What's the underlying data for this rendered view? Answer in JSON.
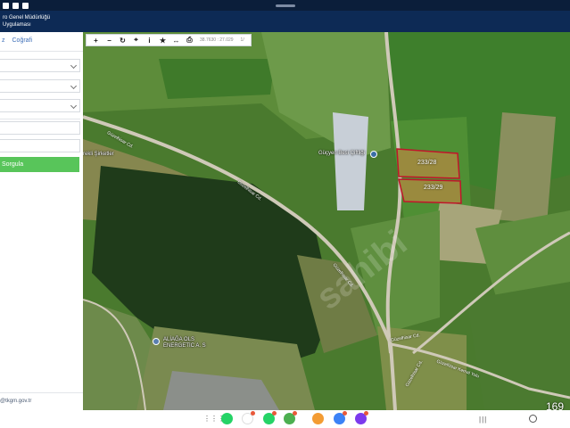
{
  "statusbar": {
    "left_text": ""
  },
  "header": {
    "line1": "ro Genel Müdürlüğü",
    "line2": "Uygulaması"
  },
  "sidebar": {
    "tabs": [
      {
        "label": "z"
      },
      {
        "label": "Coğrafi"
      }
    ],
    "query_button": "Sorgula",
    "email": "@tkgm.gov.tr"
  },
  "toolbar": {
    "buttons": [
      {
        "icon": "zoom-in-icon",
        "glyph": "+"
      },
      {
        "icon": "zoom-out-icon",
        "glyph": "−"
      },
      {
        "icon": "refresh-icon",
        "glyph": "↻"
      },
      {
        "icon": "crosshair-icon",
        "glyph": "⌖"
      },
      {
        "icon": "info-icon",
        "glyph": "i"
      },
      {
        "icon": "star-icon",
        "glyph": "★"
      },
      {
        "icon": "measure-icon",
        "glyph": "↔"
      },
      {
        "icon": "print-icon",
        "glyph": "⎙"
      }
    ],
    "coords": "38.7630 : 27.029",
    "extra": "1/"
  },
  "map": {
    "labels": {
      "farm": "Güçyen Besi Çiftliği",
      "energy_line1": "ALİAĞA OLS",
      "energy_line2": "ENERGETİC A. S",
      "left_edge": "rekli Şirketler",
      "road1": "Güzelhisar Cd.",
      "road2": "Güzelhisar Cd.",
      "road3": "Güzelhisar Cd.",
      "road4": "Güzelhisar Cd.",
      "road5": "Güzelhisar Cd.",
      "road6": "Güzelhisar Kemal Yolu"
    },
    "parcels": [
      {
        "label": "233/28"
      },
      {
        "label": "233/29"
      }
    ],
    "watermark": "sahibi",
    "corner_number": "169"
  },
  "colors": {
    "header": "#0d2a55",
    "accent": "#58c55a",
    "parcel_border": "#c0152a"
  }
}
